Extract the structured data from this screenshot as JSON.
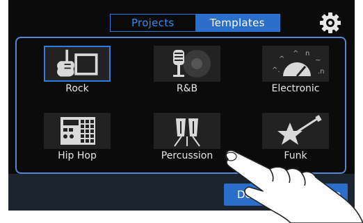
{
  "tabs": [
    {
      "label": "Projects",
      "active": false
    },
    {
      "label": "Templates",
      "active": true
    }
  ],
  "templates": [
    {
      "label": "Rock",
      "icon": "electric-guitar-amp-icon",
      "selected": true
    },
    {
      "label": "R&B",
      "icon": "microphone-record-icon",
      "selected": false
    },
    {
      "label": "Electronic",
      "icon": "synth-knobs-icon",
      "selected": false
    },
    {
      "label": "Hip Hop",
      "icon": "drum-machine-icon",
      "selected": false
    },
    {
      "label": "Percussion",
      "icon": "congas-icon",
      "selected": false
    },
    {
      "label": "Funk",
      "icon": "star-guitar-icon",
      "selected": false
    }
  ],
  "bottom_buttons": {
    "detail_label": "Detai",
    "use_label": "e"
  },
  "colors": {
    "accent": "#2b6fcb",
    "panel_border": "#5a84d4",
    "background": "#0b0b0b",
    "bottom_bar": "#1c2430"
  }
}
